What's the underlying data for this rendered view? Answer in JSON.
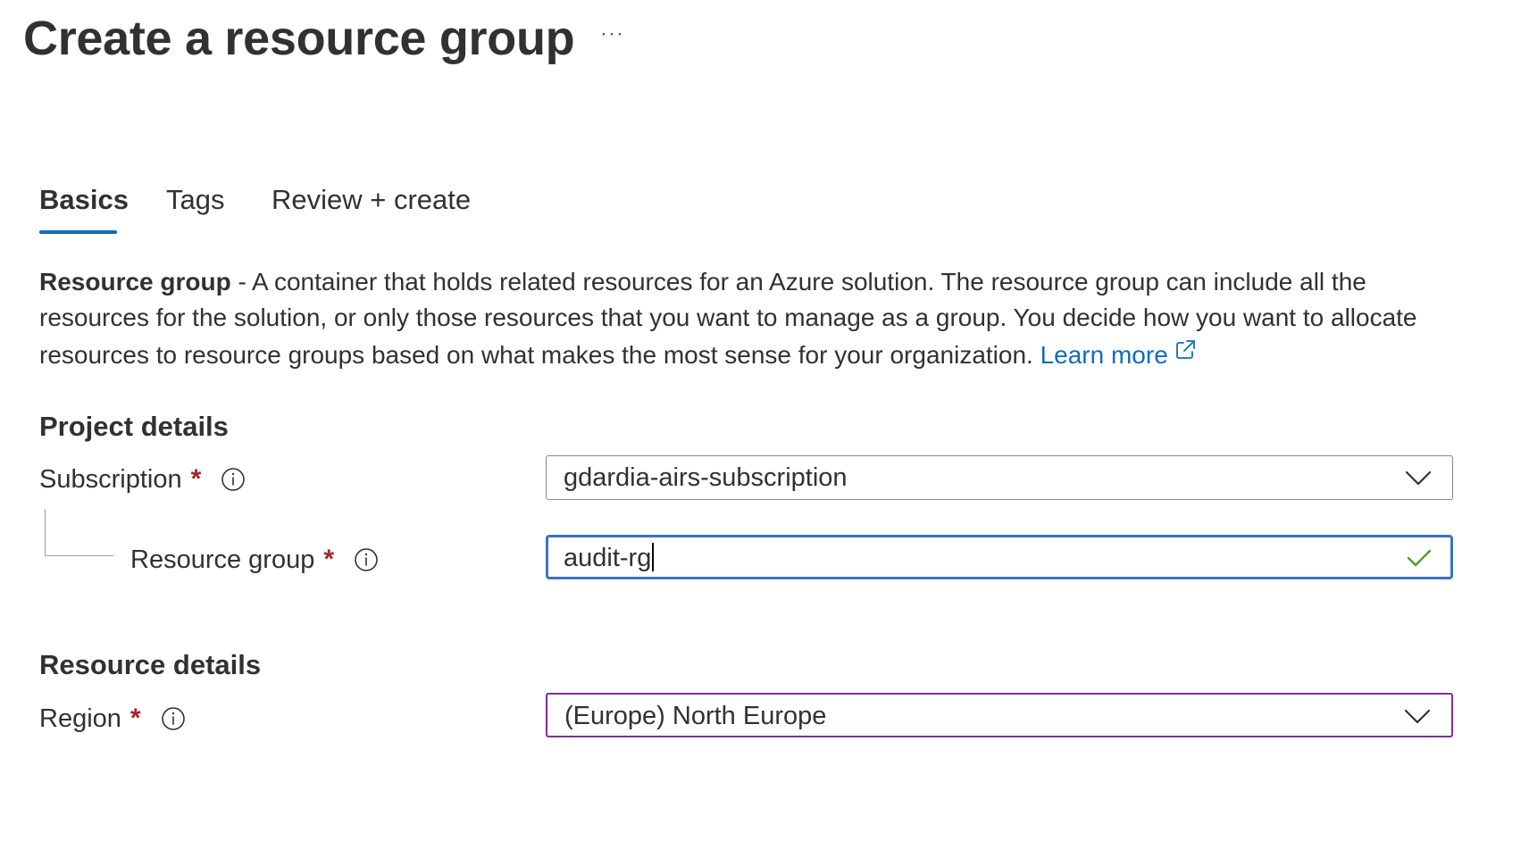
{
  "page": {
    "title": "Create a resource group",
    "more_label": "···"
  },
  "tabs": [
    {
      "label": "Basics",
      "active": true
    },
    {
      "label": "Tags",
      "active": false
    },
    {
      "label": "Review + create",
      "active": false
    }
  ],
  "description": {
    "strong": "Resource group",
    "text": " - A container that holds related resources for an Azure solution. The resource group can include all the resources for the solution, or only those resources that you want to manage as a group. You decide how you want to allocate resources to resource groups based on what makes the most sense for your organization. ",
    "link_label": "Learn more"
  },
  "project_details": {
    "heading": "Project details",
    "subscription": {
      "label": "Subscription",
      "required_mark": "*",
      "value": "gdardia-airs-subscription"
    },
    "resource_group": {
      "label": "Resource group",
      "required_mark": "*",
      "value": "audit-rg",
      "valid": true
    }
  },
  "resource_details": {
    "heading": "Resource details",
    "region": {
      "label": "Region",
      "required_mark": "*",
      "value": "(Europe) North Europe"
    }
  },
  "colors": {
    "accent": "#0f6cbd",
    "required": "#a4262c",
    "focus_border": "#3a72c9",
    "valid_check": "#4f9c2d",
    "region_border": "#7b2f9e"
  },
  "icons": {
    "more": "more-icon",
    "info": "info-icon",
    "dropdown": "chevron-down-icon",
    "valid": "checkmark-icon",
    "external": "external-link-icon"
  }
}
